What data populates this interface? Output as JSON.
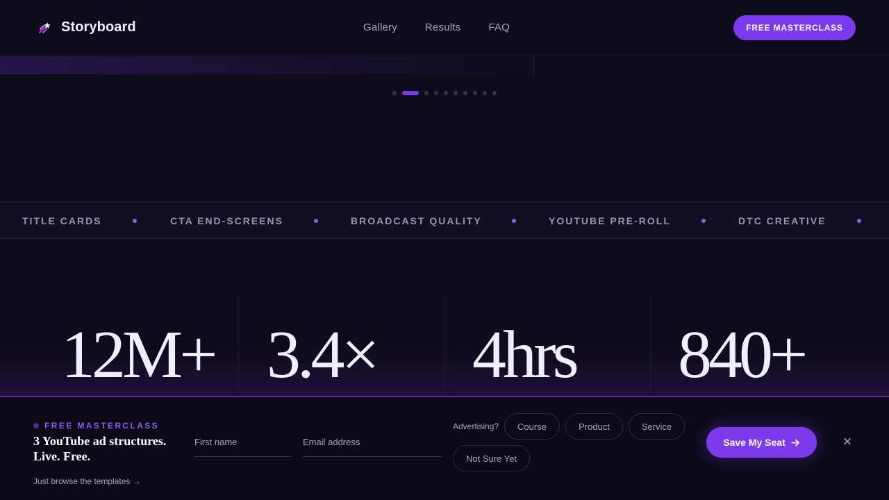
{
  "header": {
    "brand": "Storyboard",
    "logo_icon": "shooting-star-icon",
    "nav": [
      "Gallery",
      "Results",
      "FAQ"
    ],
    "cta_label": "FREE MASTERCLASS"
  },
  "carousel": {
    "slide_count": 10,
    "active_index": 1
  },
  "marquee": {
    "items": [
      "TITLE CARDS",
      "CTA END-SCREENS",
      "BROADCAST QUALITY",
      "YOUTUBE PRE-ROLL",
      "DTC CREATIVE"
    ]
  },
  "stats": [
    "12M+",
    "3.4×",
    "4hrs",
    "840+"
  ],
  "signup": {
    "kicker": "FREE MASTERCLASS",
    "title": "3 YouTube ad structures. Live. Free.",
    "browse_link": "Just browse the templates →",
    "first_name_placeholder": "First name",
    "email_placeholder": "Email address",
    "advertising_label": "Advertising?",
    "options": [
      "Course",
      "Product",
      "Service",
      "Not Sure Yet"
    ],
    "submit_label": "Save My Seat",
    "submit_icon": "arrow-right-icon",
    "close_label": "×"
  },
  "colors": {
    "background": "#0e0b1a",
    "accent": "#7c3aed",
    "muted_text": "#a9a2c4"
  }
}
